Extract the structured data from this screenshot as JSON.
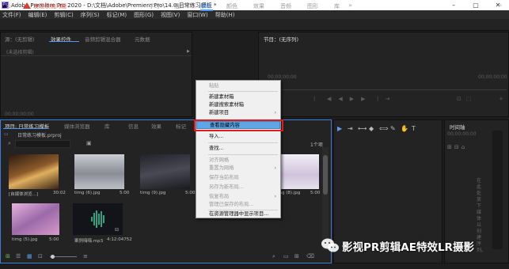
{
  "window": {
    "title": "Adobe Premiere Pro 2020 - D:\\文档\\Adobe\\Premiere Pro\\14.0\\日常练习模板 *",
    "app_icon": "Pr",
    "controls": [
      "–",
      "▢",
      "✕"
    ]
  },
  "menu": [
    "文件(F)",
    "编辑(E)",
    "剪辑(C)",
    "序列(S)",
    "标记(M)",
    "图形(G)",
    "视图(V)",
    "窗口(W)",
    "帮助(H)"
  ],
  "toolbar": {
    "warning_text": "发现系统问题",
    "workspaces": [
      "学习",
      "组件",
      "编辑",
      "颜色",
      "效果",
      "音频",
      "图形",
      "库"
    ],
    "active_workspace": "编辑",
    "more": "»"
  },
  "source_panel": {
    "tabs": [
      "源：(无剪辑)",
      "效果控件",
      "音频剪辑混合器",
      "元数据"
    ],
    "active_tab": "效果控件",
    "message": "(未选择剪辑)",
    "timecode": "00;00;00;00"
  },
  "program_panel": {
    "title": "节目：(无序列)",
    "timecode_left": "00;00;00;00",
    "timecode_right": "00;00;00;00"
  },
  "project_panel": {
    "tabs": [
      "项目: 日常练习模板",
      "媒体浏览器",
      "库",
      "信息",
      "效果",
      "标记"
    ],
    "active_tab": "项目: 日常练习模板",
    "file": "日常练习模板.prproj",
    "item_count": "1个项",
    "items": [
      {
        "name": "[自媒体浏览...]",
        "duration": "30:02",
        "color": "#6d4a2c"
      },
      {
        "name": "timg (6).jpg",
        "duration": "5:00",
        "color": "#9b9ea6"
      },
      {
        "name": "timg (9).jpg",
        "duration": "5:00",
        "color": "#3a3a44"
      },
      {
        "name": "timg (8).jpg",
        "duration": "5:00",
        "color": "#c7b8d8"
      },
      {
        "name": "timg (5).jpg",
        "duration": "5:00",
        "color": "#b57ba9"
      },
      {
        "name": "案例嗨嗨.mp3",
        "duration": "4:12:04752",
        "color": "#12141a"
      }
    ]
  },
  "context_menu": {
    "items": [
      {
        "label": "粘贴",
        "disabled": true,
        "submenu": false
      },
      {
        "label": "新建素材箱",
        "disabled": false,
        "submenu": false
      },
      {
        "label": "新建搜索素材箱",
        "disabled": false,
        "submenu": false
      },
      {
        "label": "新建项目",
        "disabled": false,
        "submenu": true
      },
      {
        "label": "查看隐藏内容",
        "disabled": false,
        "submenu": false,
        "highlighted": true
      },
      {
        "label": "导入...",
        "disabled": false,
        "submenu": false
      },
      {
        "label": "查找...",
        "disabled": false,
        "submenu": false
      },
      {
        "label": "对齐网格",
        "disabled": true,
        "submenu": false
      },
      {
        "label": "重置为网格",
        "disabled": true,
        "submenu": true
      },
      {
        "label": "保存当前布局",
        "disabled": true,
        "submenu": false
      },
      {
        "label": "另存为新布局...",
        "disabled": true,
        "submenu": false
      },
      {
        "label": "恢复布局",
        "disabled": true,
        "submenu": true
      },
      {
        "label": "管理已保存的布局...",
        "disabled": true,
        "submenu": false
      },
      {
        "label": "在资源管理器中显示项目...",
        "disabled": false,
        "submenu": false
      }
    ]
  },
  "timeline_panel": {
    "title": "时间轴",
    "timecode": "00;00;00;00",
    "hint": "在此处放下媒体以创建序列。"
  },
  "watermark": {
    "text": "影视PR剪辑AE特效LR摄影"
  }
}
